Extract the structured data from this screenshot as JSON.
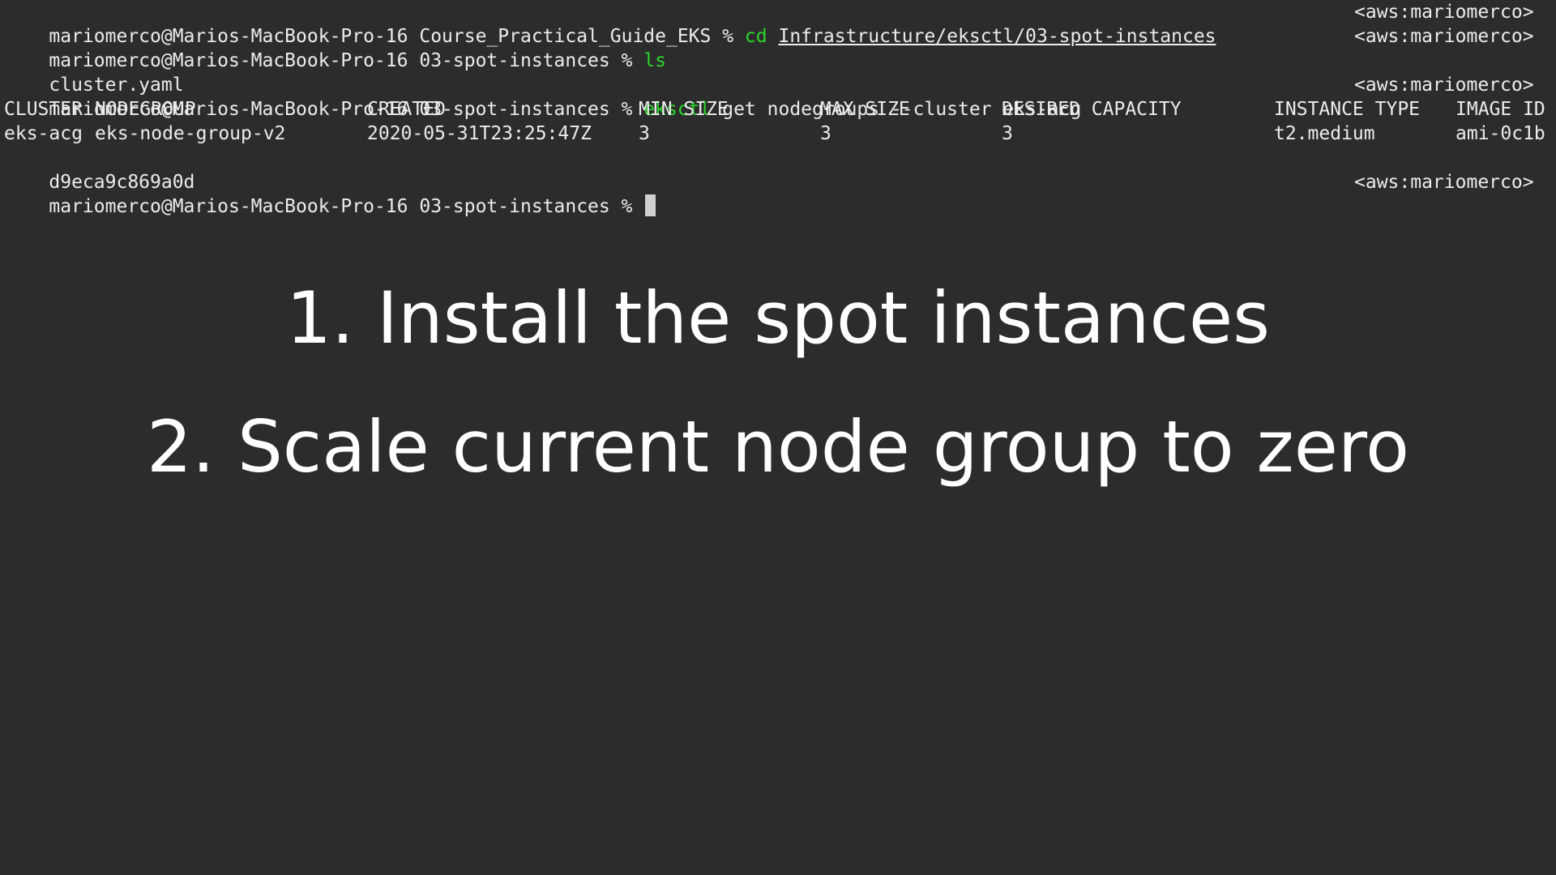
{
  "terminal": {
    "rprompt": "<aws:mariomerco>",
    "line1": {
      "prompt": "mariomerco@Marios-MacBook-Pro-16 Course_Practical_Guide_EKS % ",
      "cmd": "cd",
      "space": " ",
      "path": "Infrastructure/eksctl/03-spot-instances"
    },
    "line2": {
      "prompt": "mariomerco@Marios-MacBook-Pro-16 03-spot-instances % ",
      "cmd": "ls"
    },
    "line3": {
      "output": "cluster.yaml"
    },
    "line4": {
      "prompt": "mariomerco@Marios-MacBook-Pro-16 03-spot-instances % ",
      "cmd": "eksctl",
      "args": " get nodegroups --cluster eks-acg"
    },
    "table": {
      "headers": [
        "CLUSTER",
        "NODEGROUP",
        "CREATED",
        "MIN SIZE",
        "MAX SIZE",
        "DESIRED CAPACITY",
        "INSTANCE TYPE",
        "IMAGE ID"
      ],
      "row": [
        "eks-acg",
        "eks-node-group-v2",
        "2020-05-31T23:25:47Z",
        "3",
        "3",
        "3",
        "t2.medium",
        "ami-0c1b"
      ],
      "wrap": "d9eca9c869a0d"
    },
    "line_last": {
      "prompt": "mariomerco@Marios-MacBook-Pro-16 03-spot-instances % "
    }
  },
  "overlay": {
    "step1": "1. Install the spot instances",
    "step2": "2. Scale current node group to zero"
  }
}
